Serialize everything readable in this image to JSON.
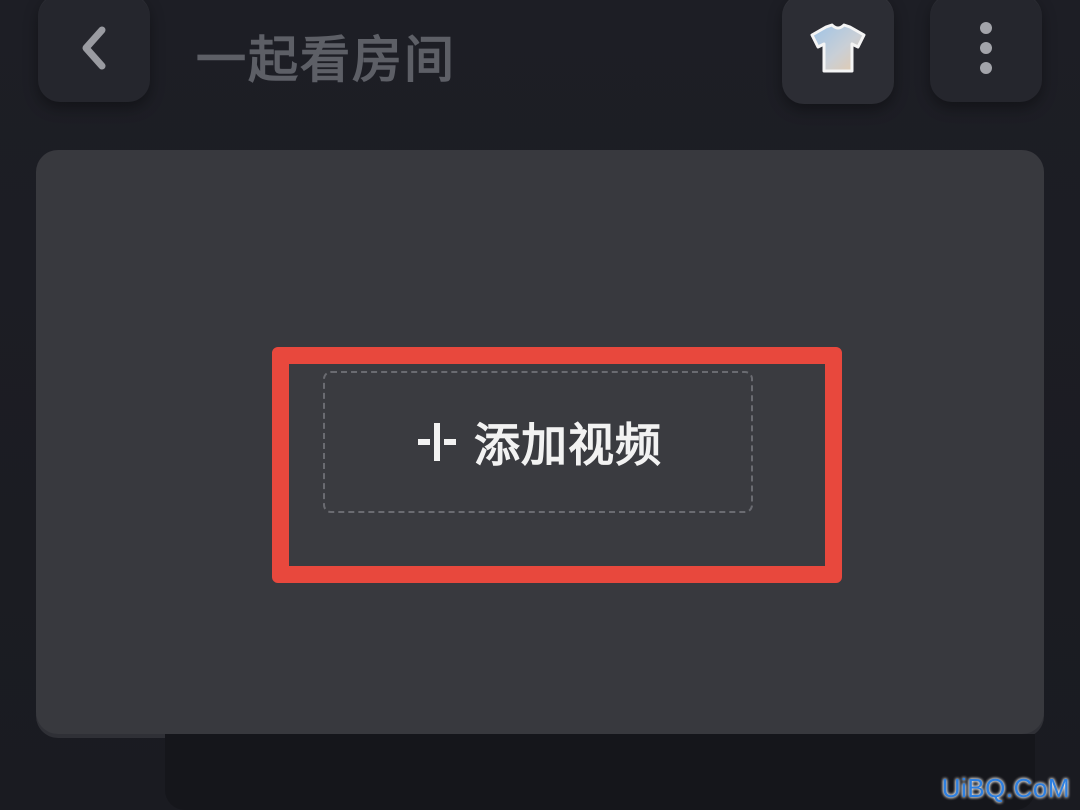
{
  "header": {
    "title": "一起看房间",
    "back_icon": "chevron-left-icon",
    "skin_icon": "tshirt-icon",
    "more_icon": "more-vertical-icon"
  },
  "player": {
    "add_video_label": "添加视频",
    "add_icon": "plus-icon"
  },
  "colors": {
    "background": "#1b1c22",
    "panel": "#38393e",
    "highlight_border": "#e8483d",
    "title_text": "#5d5f66",
    "label_text": "#f2f2f2",
    "watermark": "#2d7fe0"
  },
  "watermark": {
    "text": "UiBQ.CoM"
  }
}
